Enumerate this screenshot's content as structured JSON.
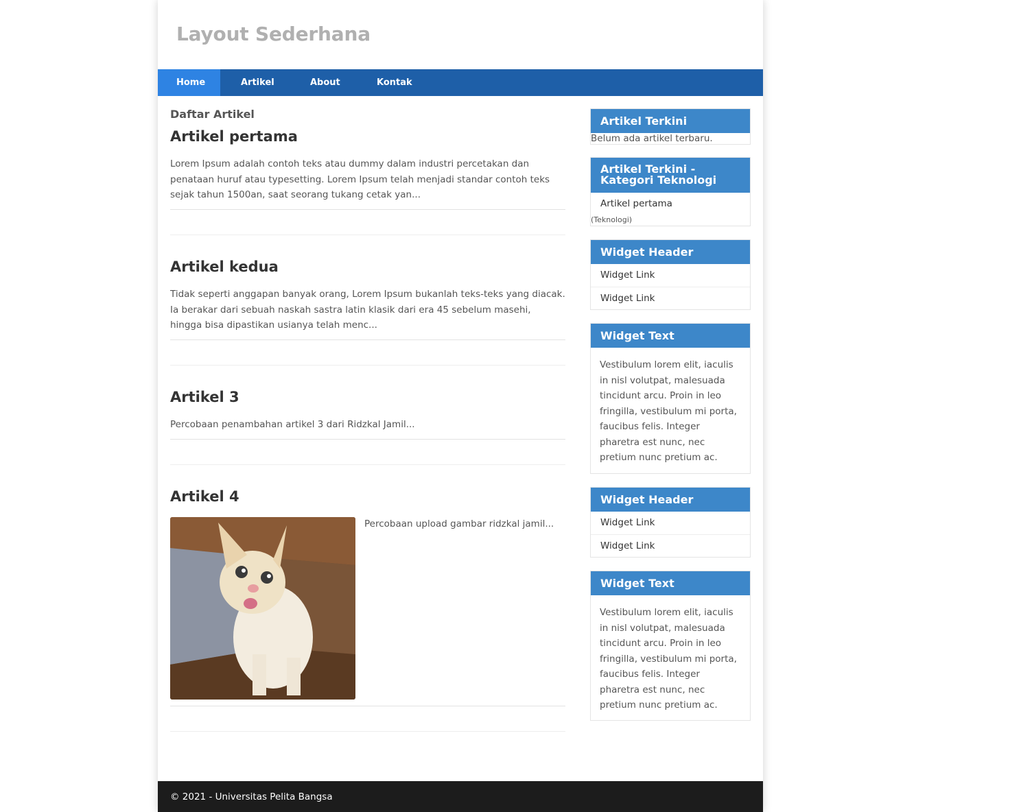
{
  "site": {
    "title": "Layout Sederhana"
  },
  "nav": {
    "items": [
      {
        "label": "Home",
        "active": true
      },
      {
        "label": "Artikel",
        "active": false
      },
      {
        "label": "About",
        "active": false
      },
      {
        "label": "Kontak",
        "active": false
      }
    ]
  },
  "content": {
    "section_title": "Daftar Artikel",
    "posts": [
      {
        "title": "Artikel pertama",
        "excerpt": "Lorem Ipsum adalah contoh teks atau dummy dalam industri percetakan dan penataan huruf atau typesetting. Lorem Ipsum telah menjadi standar contoh teks sejak tahun 1500an, saat seorang tukang cetak yan..."
      },
      {
        "title": "Artikel kedua",
        "excerpt": "Tidak seperti anggapan banyak orang, Lorem Ipsum bukanlah teks-teks yang diacak. Ia berakar dari sebuah naskah sastra latin klasik dari era 45 sebelum masehi, hingga bisa dipastikan usianya telah menc..."
      },
      {
        "title": "Artikel 3",
        "excerpt": "Percobaan penambahan artikel 3 dari Ridzkal Jamil..."
      },
      {
        "title": "Artikel 4",
        "excerpt": "Percobaan upload gambar ridzkal jamil..."
      }
    ]
  },
  "sidebar": {
    "widget_recent": {
      "header": "Artikel Terkini",
      "empty_text": "Belum ada artikel terbaru."
    },
    "widget_recent_tech": {
      "header": "Artikel Terkini - Kategori Teknologi",
      "link": "Artikel pertama",
      "category": "(Teknologi)"
    },
    "widget_links_1": {
      "header": "Widget Header",
      "links": [
        "Widget Link",
        "Widget Link"
      ]
    },
    "widget_text_1": {
      "header": "Widget Text",
      "text": "Vestibulum lorem elit, iaculis in nisl volutpat, malesuada tincidunt arcu. Proin in leo fringilla, vestibulum mi porta, faucibus felis. Integer pharetra est nunc, nec pretium nunc pretium ac."
    },
    "widget_links_2": {
      "header": "Widget Header",
      "links": [
        "Widget Link",
        "Widget Link"
      ]
    },
    "widget_text_2": {
      "header": "Widget Text",
      "text": "Vestibulum lorem elit, iaculis in nisl volutpat, malesuada tincidunt arcu. Proin in leo fringilla, vestibulum mi porta, faucibus felis. Integer pharetra est nunc, nec pretium nunc pretium ac."
    }
  },
  "footer": {
    "text": "© 2021 - Universitas Pelita Bangsa"
  },
  "colors": {
    "nav": "#1e5fa8",
    "nav_active": "#2e83e3",
    "widget_header": "#3d87c9",
    "footer": "#1c1c1c"
  }
}
